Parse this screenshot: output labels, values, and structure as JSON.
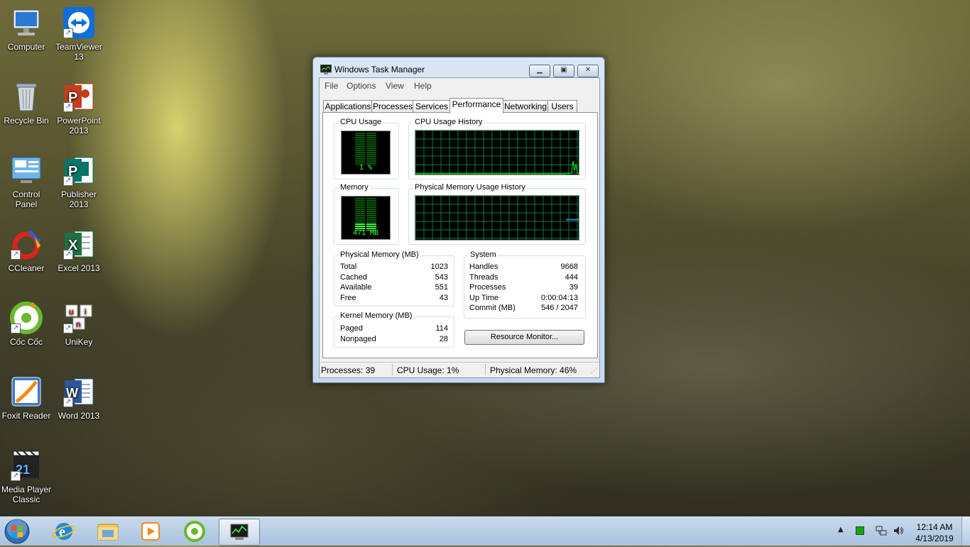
{
  "desktop": {
    "icons": [
      {
        "label_1": "Computer",
        "label_2": ""
      },
      {
        "label_1": "TeamViewer",
        "label_2": "13"
      },
      {
        "label_1": "Recycle Bin",
        "label_2": ""
      },
      {
        "label_1": "PowerPoint",
        "label_2": "2013"
      },
      {
        "label_1": "Control",
        "label_2": "Panel"
      },
      {
        "label_1": "Publisher",
        "label_2": "2013"
      },
      {
        "label_1": "CCleaner",
        "label_2": ""
      },
      {
        "label_1": "Excel 2013",
        "label_2": ""
      },
      {
        "label_1": "Cốc Cốc",
        "label_2": ""
      },
      {
        "label_1": "UniKey",
        "label_2": ""
      },
      {
        "label_1": "Foxit Reader",
        "label_2": ""
      },
      {
        "label_1": "Word 2013",
        "label_2": ""
      },
      {
        "label_1": "Media Player",
        "label_2": "Classic"
      }
    ]
  },
  "window": {
    "title": "Windows Task Manager",
    "menu": [
      "File",
      "Options",
      "View",
      "Help"
    ],
    "tabs": [
      "Applications",
      "Processes",
      "Services",
      "Performance",
      "Networking",
      "Users"
    ],
    "active_tab": "Performance",
    "cpu_usage": {
      "title": "CPU Usage",
      "value_text": "1 %",
      "percent": 1
    },
    "cpu_history": {
      "title": "CPU Usage History"
    },
    "memory": {
      "title": "Memory",
      "value_text": "471 MB",
      "percent": 46
    },
    "memory_history": {
      "title": "Physical Memory Usage History"
    },
    "physical_memory": {
      "title": "Physical Memory (MB)",
      "rows": [
        {
          "k": "Total",
          "v": "1023"
        },
        {
          "k": "Cached",
          "v": "543"
        },
        {
          "k": "Available",
          "v": "551"
        },
        {
          "k": "Free",
          "v": "43"
        }
      ]
    },
    "kernel_memory": {
      "title": "Kernel Memory (MB)",
      "rows": [
        {
          "k": "Paged",
          "v": "114"
        },
        {
          "k": "Nonpaged",
          "v": "28"
        }
      ]
    },
    "system": {
      "title": "System",
      "rows": [
        {
          "k": "Handles",
          "v": "9668"
        },
        {
          "k": "Threads",
          "v": "444"
        },
        {
          "k": "Processes",
          "v": "39"
        },
        {
          "k": "Up Time",
          "v": "0:00:04:13"
        },
        {
          "k": "Commit (MB)",
          "v": "546 / 2047"
        }
      ]
    },
    "resource_monitor_label": "Resource Monitor...",
    "status": {
      "processes": "Processes: 39",
      "cpu": "CPU Usage: 1%",
      "memory": "Physical Memory: 46%"
    },
    "colors": {
      "graph_grid": "#008040",
      "graph_line": "#00ff00",
      "meter_on": "#3cff3c",
      "meter_off": "#0b5a0b"
    }
  },
  "taskbar": {
    "clock_time": "12:14 AM",
    "clock_date": "4/13/2019",
    "apps": [
      "start-orb-icon",
      "internet-explorer-icon",
      "file-explorer-icon",
      "media-player-icon",
      "coc-coc-icon",
      "task-manager-icon"
    ]
  }
}
